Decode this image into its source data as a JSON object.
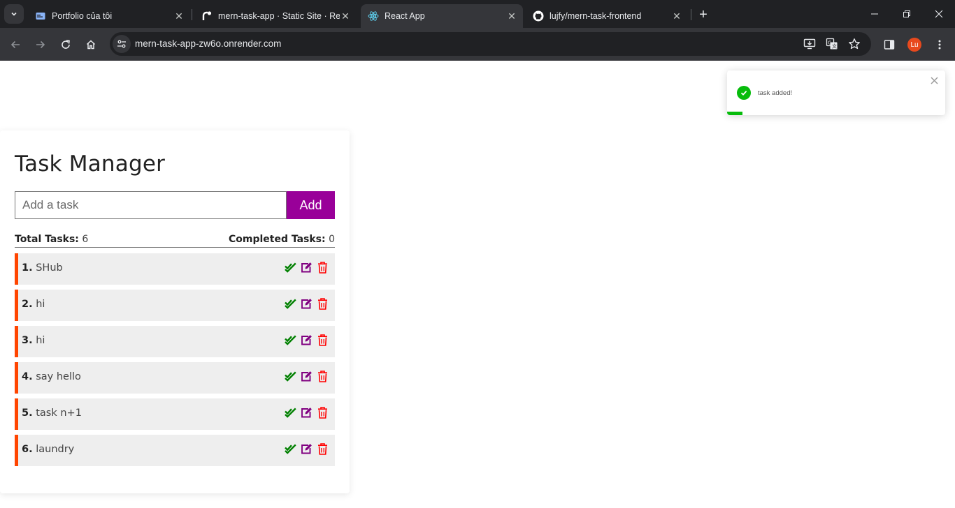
{
  "browser": {
    "tabs": [
      {
        "title": "Portfolio của tôi",
        "favicon": "portfolio-favicon-icon"
      },
      {
        "title": "mern-task-app · Static Site · Re",
        "favicon": "render-favicon-icon"
      },
      {
        "title": "React App",
        "favicon": "react-favicon-icon"
      },
      {
        "title": "lujfy/mern-task-frontend",
        "favicon": "github-favicon-icon"
      }
    ],
    "active_tab": 2,
    "url": "mern-task-app-zw6o.onrender.com",
    "profile_initials": "Lu"
  },
  "toast": {
    "message": "task added!",
    "progress": 0.07,
    "color": "#07bc0c"
  },
  "app": {
    "title": "Task Manager",
    "input_placeholder": "Add a task",
    "input_value": "",
    "add_label": "Add",
    "total_label": "Total Tasks:",
    "total_count": "6",
    "completed_label": "Completed Tasks:",
    "completed_count": "0",
    "accent_color": "#990099",
    "task_border_color": "#ff4500",
    "tasks": [
      {
        "number": "1.",
        "name": "SHub"
      },
      {
        "number": "2.",
        "name": "hi"
      },
      {
        "number": "3.",
        "name": "hi"
      },
      {
        "number": "4.",
        "name": "say hello"
      },
      {
        "number": "5.",
        "name": "task n+1"
      },
      {
        "number": "6.",
        "name": "laundry"
      }
    ],
    "task_icons": [
      "double-check-icon",
      "edit-icon",
      "trash-icon"
    ]
  }
}
